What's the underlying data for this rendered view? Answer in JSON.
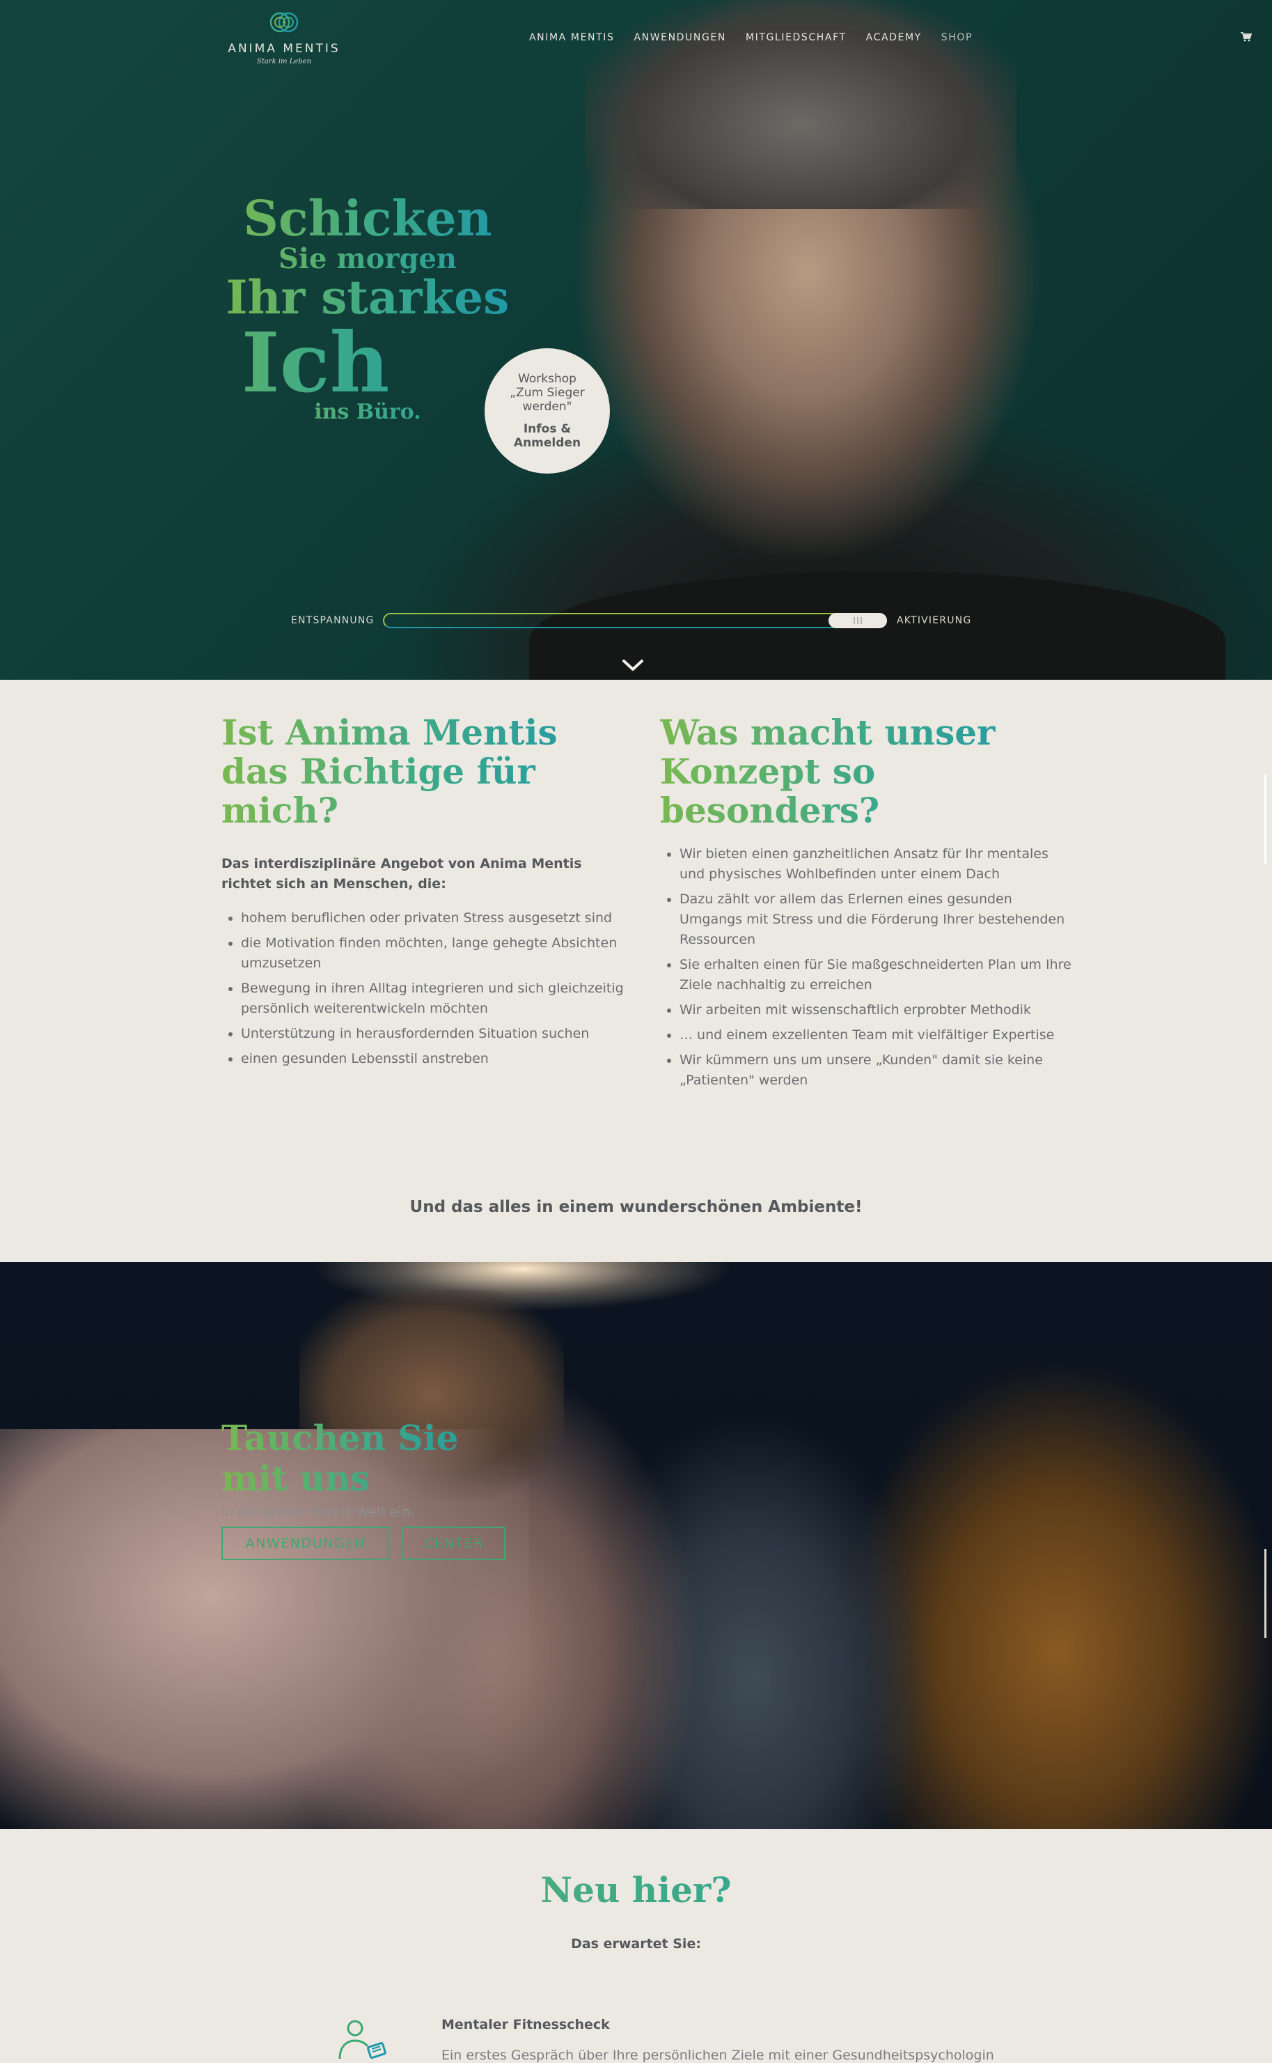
{
  "header": {
    "logo_name": "ANIMA MENTIS",
    "logo_tagline": "Stark im Leben",
    "nav": [
      "ANIMA MENTIS",
      "ANWENDUNGEN",
      "MITGLIEDSCHAFT",
      "ACADEMY",
      "SHOP"
    ],
    "cart_icon": "cart-icon"
  },
  "hero": {
    "line1": "Schicken",
    "line2": "Sie morgen",
    "line3": "Ihr starkes",
    "line4": "Ich",
    "line5": "ins Büro.",
    "badge_line1": "Workshop „Zum Sieger werden\"",
    "badge_line2": "Infos & Anmelden",
    "slider_left": "ENTSPANNUNG",
    "slider_right": "AKTIVIERUNG",
    "slider_level": 0.92,
    "scroll_icon": "chevron-down-icon"
  },
  "about": {
    "col1_title": "Ist Anima Mentis das Richtige für mich?",
    "col1_intro": "Das interdisziplinäre Angebot von Anima Mentis richtet sich an Menschen, die:",
    "col1_items": [
      "hohem beruflichen oder privaten Stress ausgesetzt sind",
      "die Motivation finden möchten, lange gehegte Absichten umzusetzen",
      "Bewegung in ihren Alltag integrieren und sich gleichzeitig persönlich weiterentwickeln möchten",
      "Unterstützung in herausfordernden Situation suchen",
      "einen gesunden Lebensstil anstreben"
    ],
    "col2_title": "Was macht unser Konzept so besonders?",
    "col2_items": [
      "Wir bieten einen ganzheitlichen Ansatz für Ihr mentales und physisches Wohlbefinden unter einem Dach",
      "Dazu zählt vor allem das Erlernen eines gesunden Umgangs mit Stress und die Förderung Ihrer bestehenden Ressourcen",
      "Sie erhalten einen für Sie maßgeschneiderten Plan um Ihre Ziele nachhaltig zu erreichen",
      "Wir arbeiten mit wissenschaftlich erprobter Methodik",
      "… und einem exzellenten Team mit vielfältiger Expertise",
      "Wir kümmern uns um unsere „Kunden\" damit sie keine „Patienten\" werden"
    ],
    "closing": "Und das alles in einem wunderschönen Ambiente!"
  },
  "dive": {
    "title": "Tauchen Sie mit uns",
    "subtitle": "in die Anima Mentis Welt ein.",
    "button1": "ANWENDUNGEN",
    "button2": "CENTER"
  },
  "new_here": {
    "title": "Neu hier?",
    "subtitle": "Das erwartet Sie:",
    "item1_title": "Mentaler Fitnesscheck",
    "item1_desc": "Ein erstes Gespräch über Ihre persönlichen Ziele mit einer Gesundheitspsychologin",
    "item1_icon": "person-clipboard-icon"
  },
  "colors": {
    "green": "#7ab850",
    "teal": "#1f98a8",
    "button": "#3ea86e",
    "background": "#ece9e2"
  }
}
